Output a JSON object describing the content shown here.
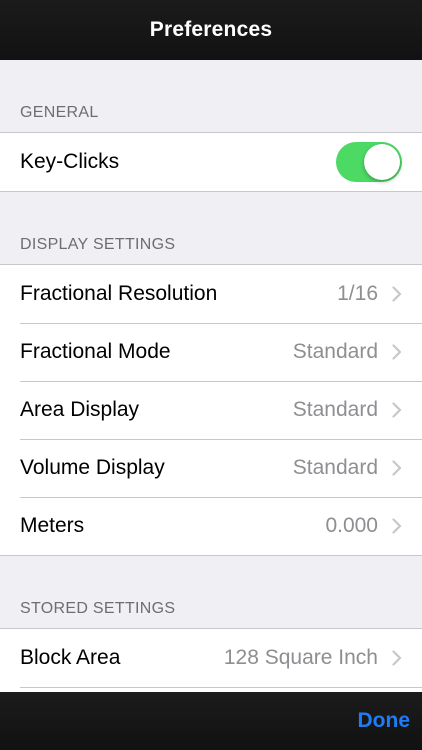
{
  "navbar": {
    "title": "Preferences"
  },
  "sections": {
    "general": {
      "header": "GENERAL",
      "key_clicks": {
        "label": "Key-Clicks",
        "enabled": true
      }
    },
    "display": {
      "header": "DISPLAY SETTINGS",
      "rows": [
        {
          "label": "Fractional Resolution",
          "value": "1/16"
        },
        {
          "label": "Fractional Mode",
          "value": "Standard"
        },
        {
          "label": "Area Display",
          "value": "Standard"
        },
        {
          "label": "Volume Display",
          "value": "Standard"
        },
        {
          "label": "Meters",
          "value": "0.000"
        }
      ]
    },
    "stored": {
      "header": "STORED SETTINGS",
      "rows": [
        {
          "label": "Block Area",
          "value": "128 Square Inch"
        }
      ]
    }
  },
  "toolbar": {
    "done_label": "Done"
  },
  "colors": {
    "toggle_on": "#4cd964",
    "accent": "#1f7cf4",
    "chevron": "#c7c7cc"
  },
  "icons": {
    "disclosure": "chevron-right-icon"
  }
}
